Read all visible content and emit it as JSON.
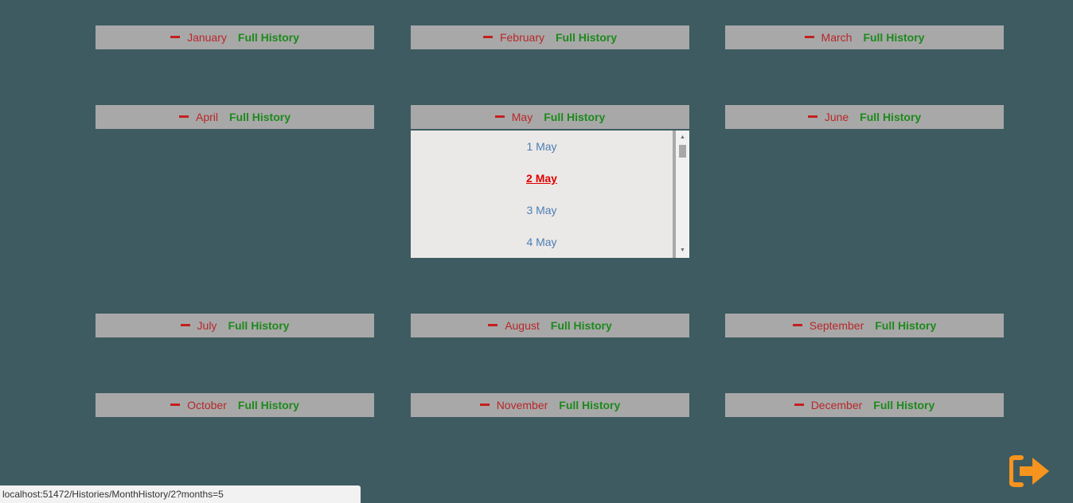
{
  "months": [
    {
      "name": "January",
      "full_history": "Full History"
    },
    {
      "name": "February",
      "full_history": "Full History"
    },
    {
      "name": "March",
      "full_history": "Full History"
    },
    {
      "name": "April",
      "full_history": "Full History"
    },
    {
      "name": "May",
      "full_history": "Full History"
    },
    {
      "name": "June",
      "full_history": "Full History"
    },
    {
      "name": "July",
      "full_history": "Full History"
    },
    {
      "name": "August",
      "full_history": "Full History"
    },
    {
      "name": "September",
      "full_history": "Full History"
    },
    {
      "name": "October",
      "full_history": "Full History"
    },
    {
      "name": "November",
      "full_history": "Full History"
    },
    {
      "name": "December",
      "full_history": "Full History"
    }
  ],
  "may_days": {
    "items": [
      "1 May",
      "2 May",
      "3 May",
      "4 May"
    ],
    "selected": "2 May"
  },
  "status_bar": {
    "url": "localhost:51472/Histories/MonthHistory/2?months=5"
  },
  "icons": {
    "collapse": "minus-icon",
    "exit": "sign-out-icon"
  },
  "colors": {
    "background": "#3e5b61",
    "header": "#a8a8a8",
    "month_name": "#b8272a",
    "full_history": "#1c8a1c",
    "day_link": "#4a7fb5",
    "day_selected": "#e10000",
    "exit_icon": "#f7941d"
  }
}
